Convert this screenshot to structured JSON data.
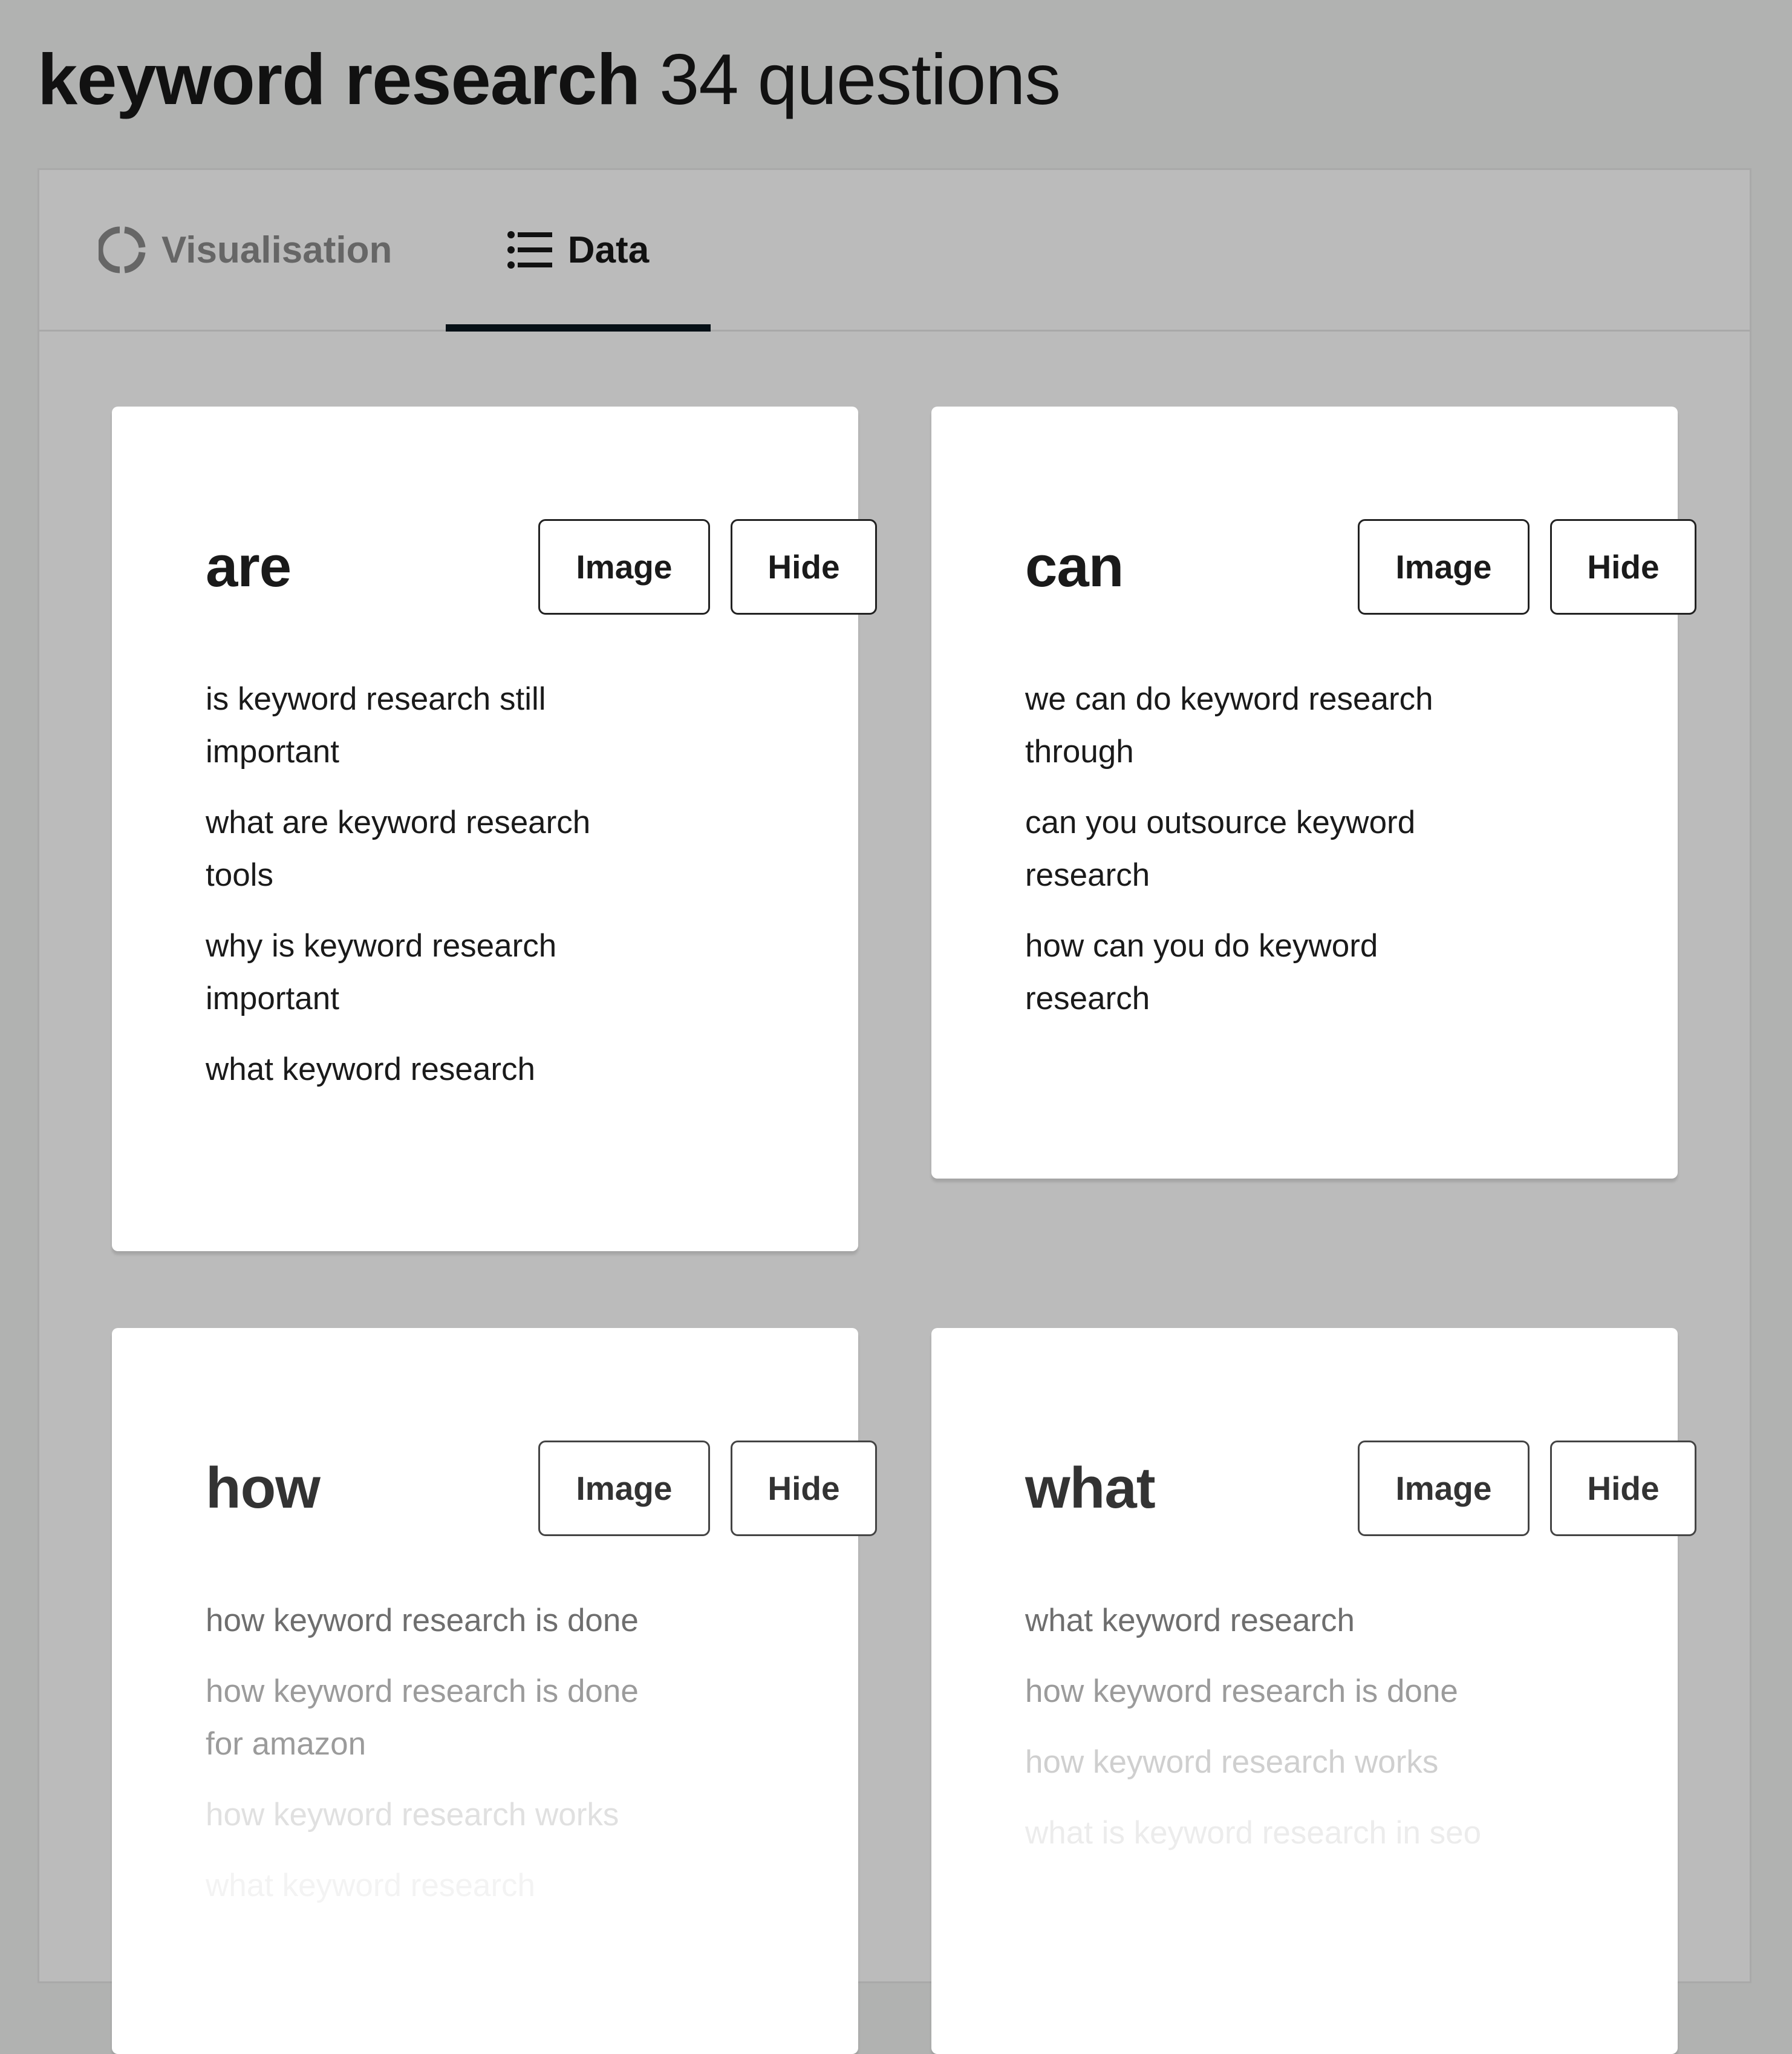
{
  "header": {
    "keyword": "keyword research",
    "count_label": "34 questions"
  },
  "tabs": [
    {
      "label": "Visualisation",
      "icon": "circle-segments-icon",
      "active": false
    },
    {
      "label": "Data",
      "icon": "list-icon",
      "active": true
    }
  ],
  "cards": [
    {
      "title": "are",
      "image_label": "Image",
      "hide_label": "Hide",
      "questions": [
        "is keyword research still important",
        "what are keyword research tools",
        "why is keyword research important",
        "what keyword research"
      ]
    },
    {
      "title": "can",
      "image_label": "Image",
      "hide_label": "Hide",
      "questions": [
        "we can do keyword research through",
        "can you outsource keyword research",
        "how can you do keyword research"
      ]
    },
    {
      "title": "how",
      "image_label": "Image",
      "hide_label": "Hide",
      "questions": [
        "how keyword research is done",
        "how keyword research is done for amazon",
        "how keyword research works",
        "what keyword research"
      ]
    },
    {
      "title": "what",
      "image_label": "Image",
      "hide_label": "Hide",
      "questions": [
        "what keyword research",
        "how keyword research is done",
        "how keyword research works",
        "what is keyword research in seo"
      ]
    }
  ],
  "colors": {
    "background": "#b1b2b1",
    "panel": "#bbbbbb",
    "tab_underline": "#061016",
    "inactive_tab": "#666666"
  }
}
